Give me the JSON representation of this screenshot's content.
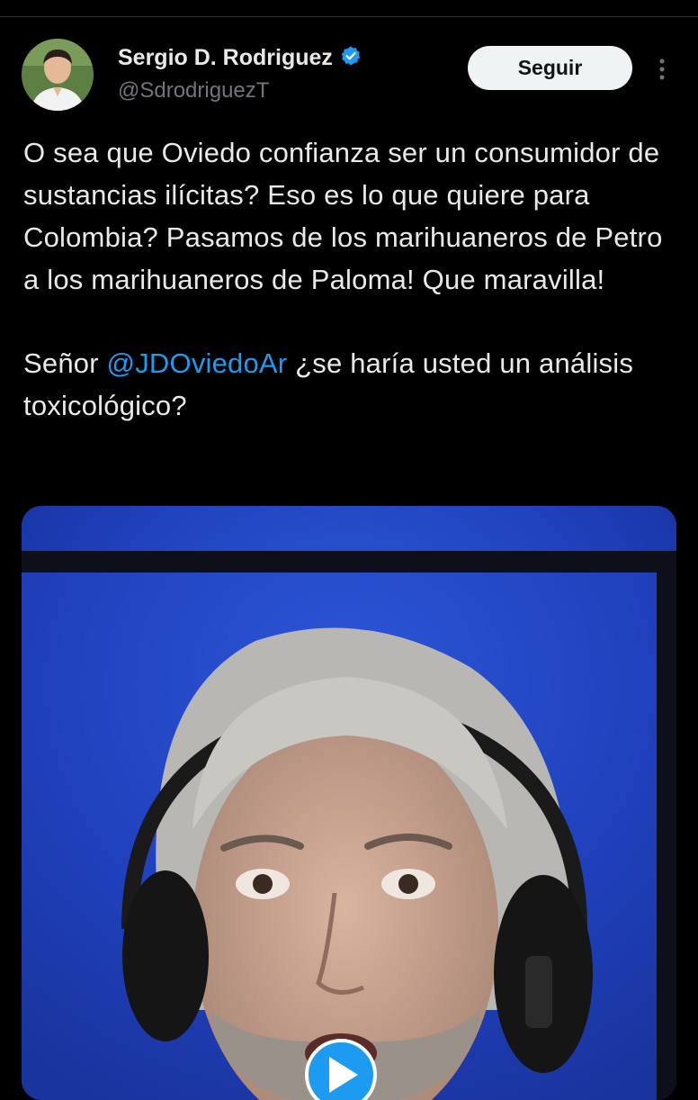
{
  "author": {
    "name": "Sergio D. Rodriguez",
    "handle": "@SdrodriguezT",
    "verified": true
  },
  "actions": {
    "follow_label": "Seguir"
  },
  "tweet": {
    "paragraph1": "O sea que Oviedo confianza ser un consumidor de sustancias ilícitas? Eso es lo que quiere para Colombia? Pasamos de los marihuaneros de Petro a los marihuaneros de Paloma! Que maravilla!",
    "p2_prefix": "Señor ",
    "mention": "@JDOviedoAr",
    "p2_suffix": " ¿se haría usted un análisis toxicológico?"
  },
  "colors": {
    "background": "#000000",
    "text": "#e7e9ea",
    "secondary": "#71767b",
    "link": "#1d9bf0",
    "verified_badge": "#1d9bf0"
  },
  "icons": {
    "verified": "verified-badge-icon",
    "more": "more-options-icon",
    "play": "play-icon"
  }
}
